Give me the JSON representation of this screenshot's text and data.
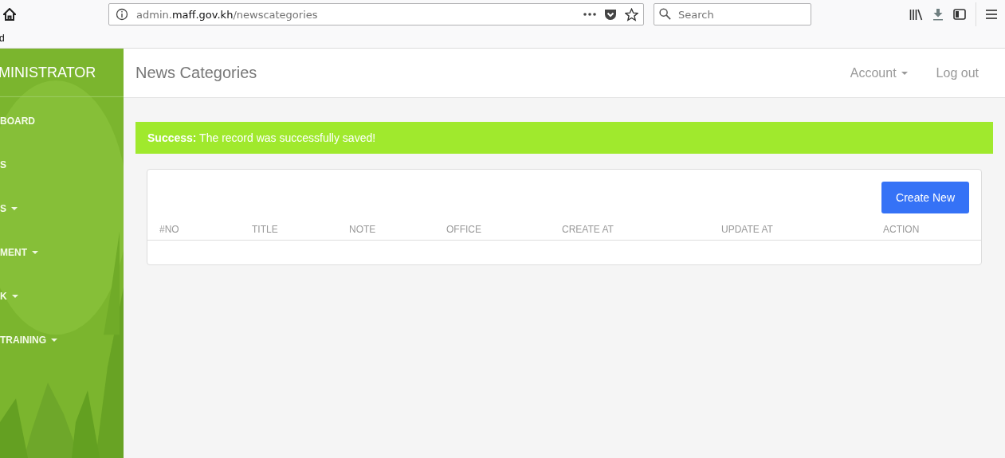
{
  "browser": {
    "url_host_pre": "admin.",
    "url_host": "maff.gov.kh",
    "url_path": "/newscategories",
    "search_placeholder": "Search",
    "bookmark": "d"
  },
  "sidebar": {
    "brand": "MINISTRATOR",
    "items": [
      {
        "label": "BOARD",
        "kind": "link"
      },
      {
        "label": "S",
        "kind": "link"
      },
      {
        "label": "S",
        "kind": "dropdown"
      },
      {
        "label": "MENT",
        "kind": "dropdown"
      },
      {
        "label": "K",
        "kind": "dropdown"
      },
      {
        "label": "TRAINING",
        "kind": "dropdown"
      }
    ]
  },
  "header": {
    "title": "News Categories",
    "nav": [
      {
        "label": "Account",
        "kind": "dropdown"
      },
      {
        "label": "Log out",
        "kind": "link"
      }
    ]
  },
  "alert": {
    "text": "**Success:** The record was successfully saved!"
  },
  "table": {
    "button": "Create New",
    "columns": [
      "#NO",
      "TITLE",
      "NOTE",
      "OFFICE",
      "CREATE AT",
      "UPDATE AT",
      "ACTION"
    ]
  }
}
